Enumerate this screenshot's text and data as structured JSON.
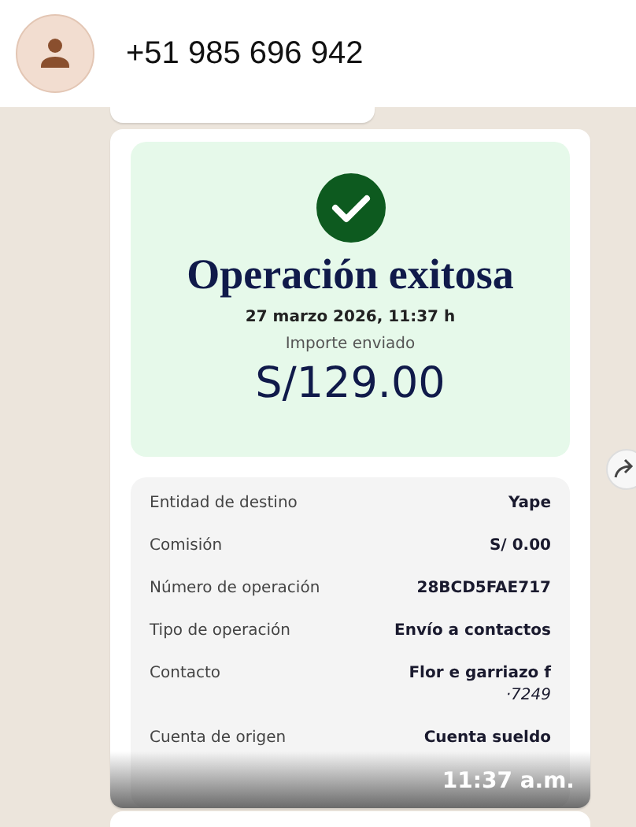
{
  "header": {
    "contact": "+51 985 696 942"
  },
  "message": {
    "receipt": {
      "title": "Operación exitosa",
      "datetime": "27 marzo 2026, 11:37 h",
      "amount_label": "Importe enviado",
      "amount": "S/129.00",
      "details": [
        {
          "label": "Entidad de destino",
          "value": [
            "Yape"
          ]
        },
        {
          "label": "Comisión",
          "value": [
            "S/ 0.00"
          ]
        },
        {
          "label": "Número de operación",
          "value": [
            "28BCD5FAE717"
          ]
        },
        {
          "label": "Tipo de operación",
          "value": [
            "Envío a contactos"
          ]
        },
        {
          "label": "Contacto",
          "value": [
            "Flor e garriazo f",
            "·7249"
          ]
        },
        {
          "label": "Cuenta de origen",
          "value": [
            "Cuenta sueldo"
          ]
        }
      ]
    },
    "time": "11:37 a.m."
  }
}
